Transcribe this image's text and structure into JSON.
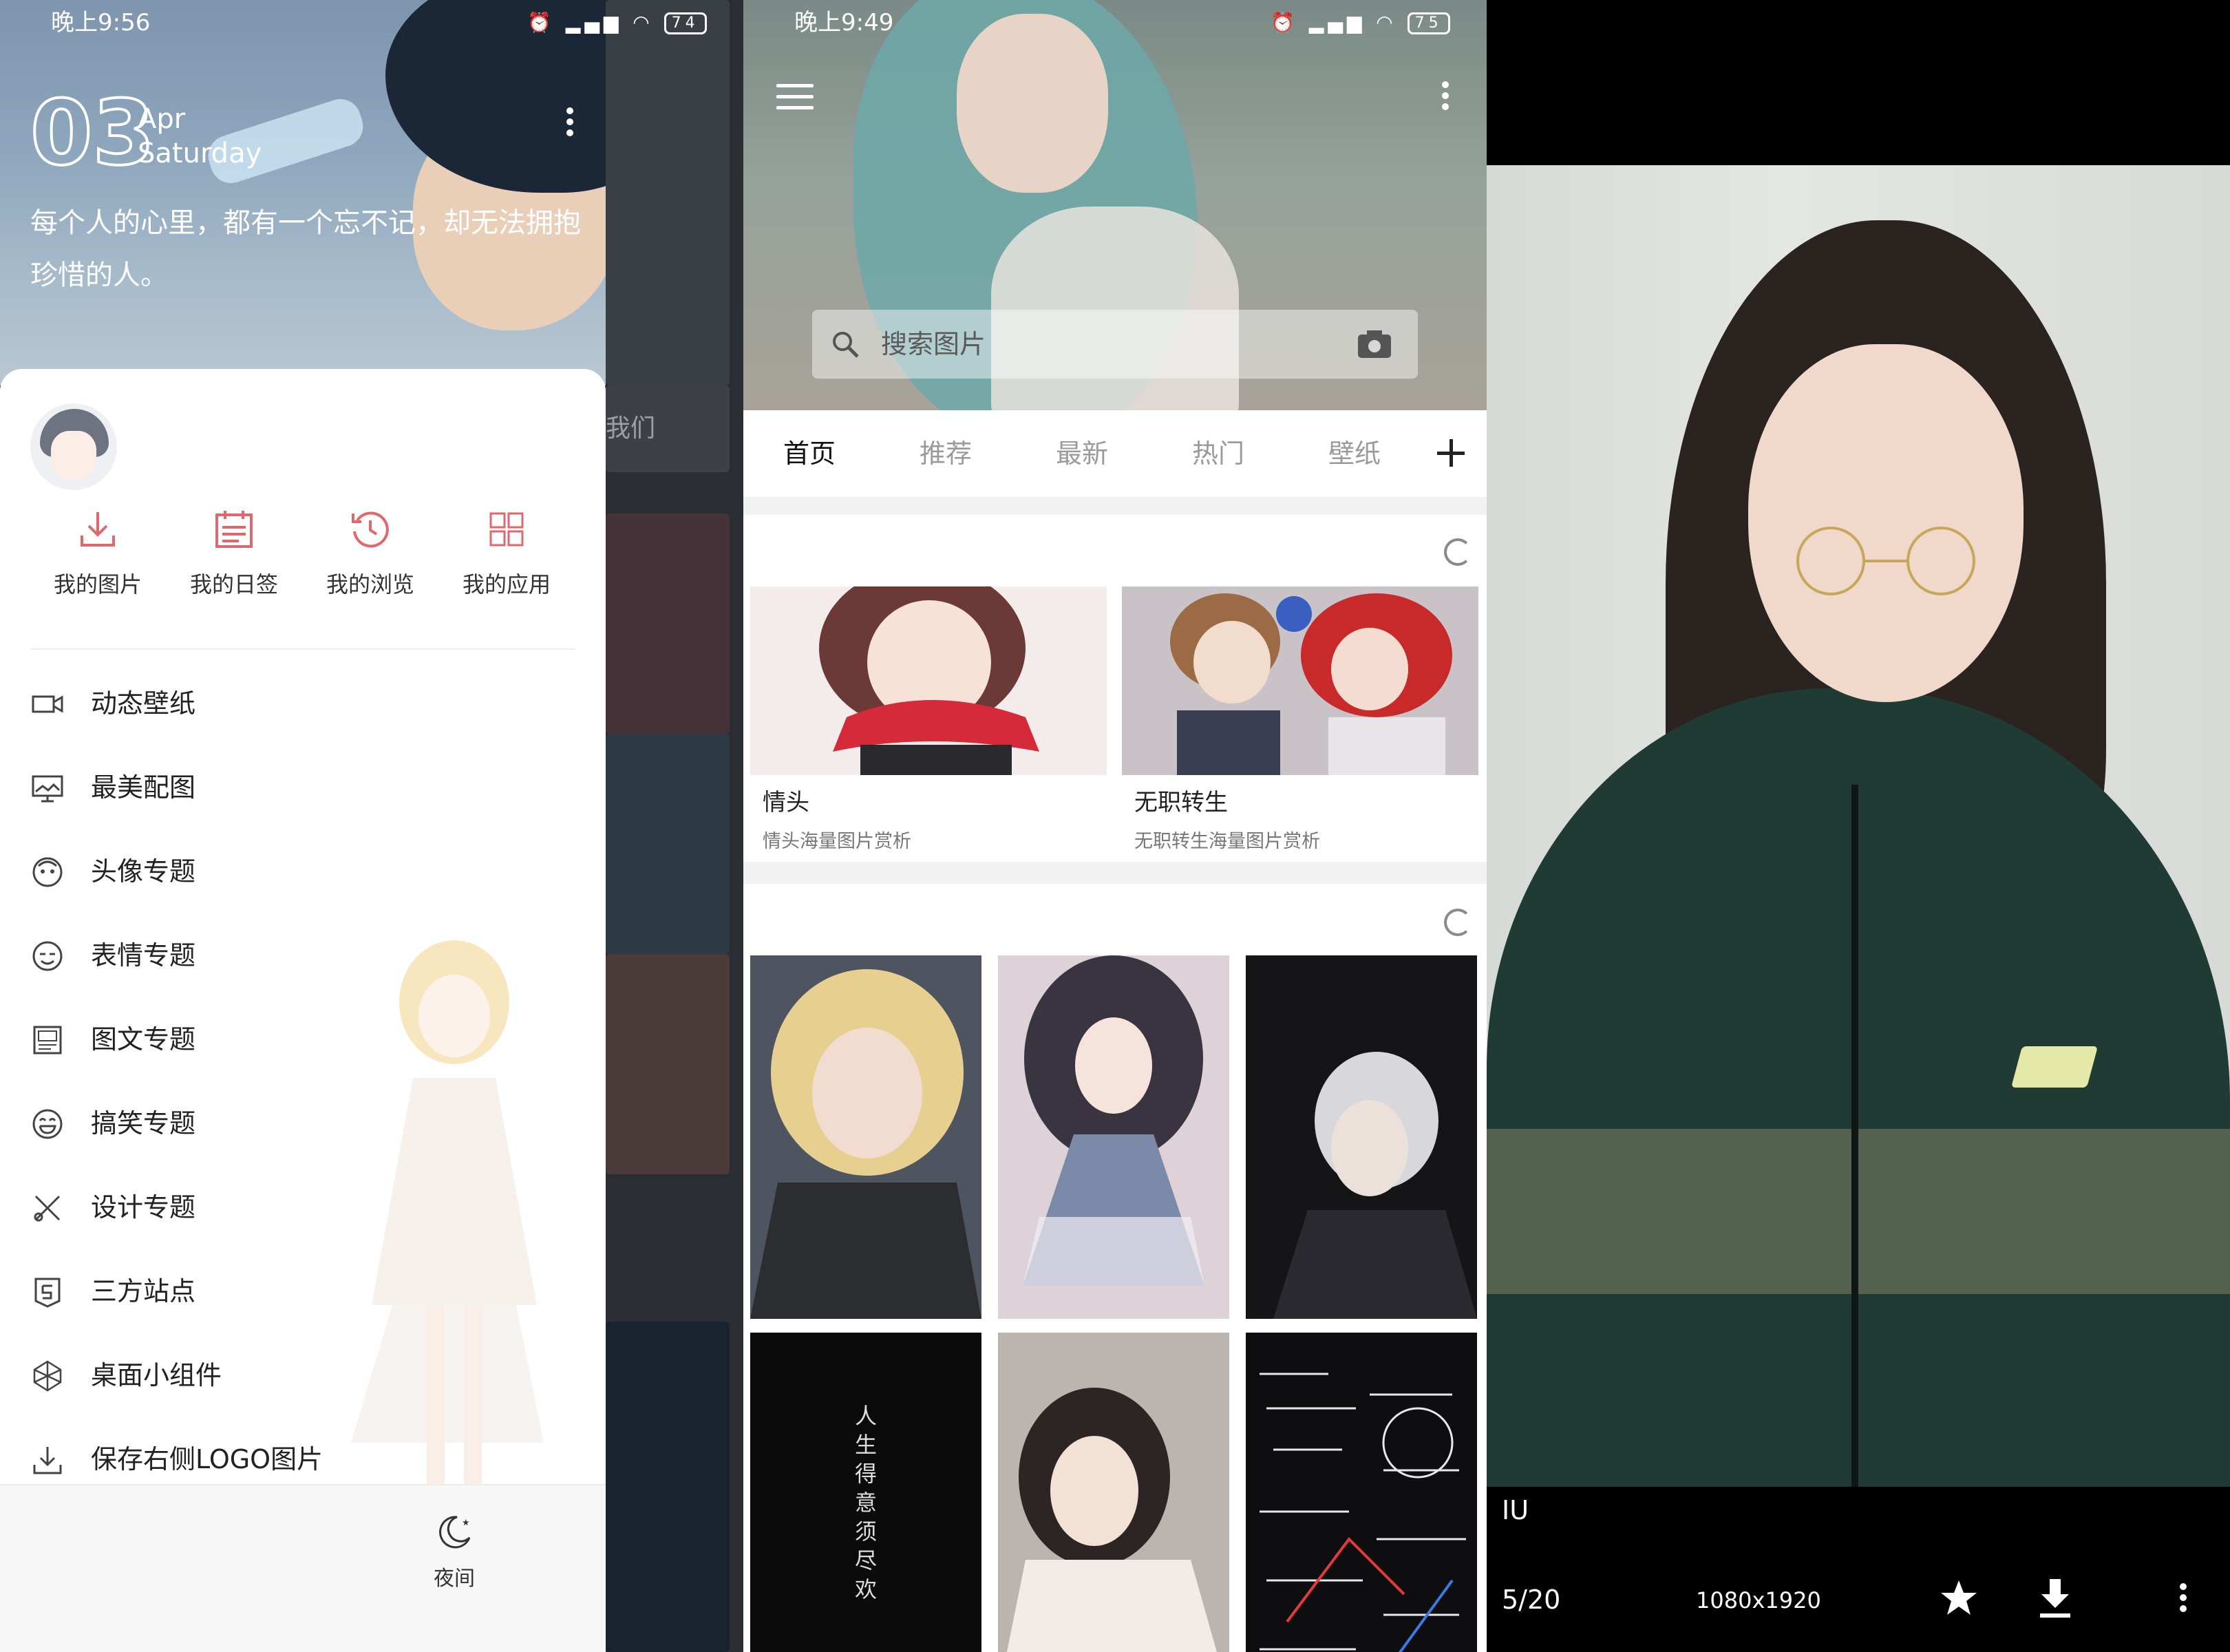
{
  "panel1": {
    "status": {
      "time": "晚上9:56",
      "battery": "74"
    },
    "date": {
      "day": "03",
      "month": "Apr",
      "weekday": "Saturday"
    },
    "quote": "每个人的心里，都有一个忘不记，却无法拥抱珍惜的人。",
    "behind_tab_text": "我们",
    "quick_actions": [
      {
        "label": "我的图片",
        "icon": "download-icon"
      },
      {
        "label": "我的日签",
        "icon": "calendar-icon"
      },
      {
        "label": "我的浏览",
        "icon": "history-icon"
      },
      {
        "label": "我的应用",
        "icon": "grid-icon"
      }
    ],
    "menu": [
      {
        "label": "动态壁纸",
        "icon": "video-icon"
      },
      {
        "label": "最美配图",
        "icon": "monitor-icon"
      },
      {
        "label": "头像专题",
        "icon": "avatar-icon"
      },
      {
        "label": "表情专题",
        "icon": "emoji-icon"
      },
      {
        "label": "图文专题",
        "icon": "image-text-icon"
      },
      {
        "label": "搞笑专题",
        "icon": "laugh-icon"
      },
      {
        "label": "设计专题",
        "icon": "design-tools-icon"
      },
      {
        "label": "三方站点",
        "icon": "site-icon"
      },
      {
        "label": "桌面小组件",
        "icon": "widget-icon"
      },
      {
        "label": "保存右侧LOGO图片",
        "icon": "save-icon"
      }
    ],
    "night_label": "夜间",
    "accent_color": "#e0676d"
  },
  "panel2": {
    "status": {
      "time": "晚上9:49",
      "battery": "75"
    },
    "search_placeholder": "搜索图片",
    "tabs": [
      "首页",
      "推荐",
      "最新",
      "热门",
      "壁纸"
    ],
    "topic_cards": [
      {
        "title": "情头",
        "subtitle": "情头海量图片赏析"
      },
      {
        "title": "无职转生",
        "subtitle": "无职转生海量图片赏析"
      }
    ],
    "poster_text": "人生得意须尽欢"
  },
  "panel3": {
    "name": "IU",
    "index": "5/20",
    "resolution": "1080x1920"
  }
}
